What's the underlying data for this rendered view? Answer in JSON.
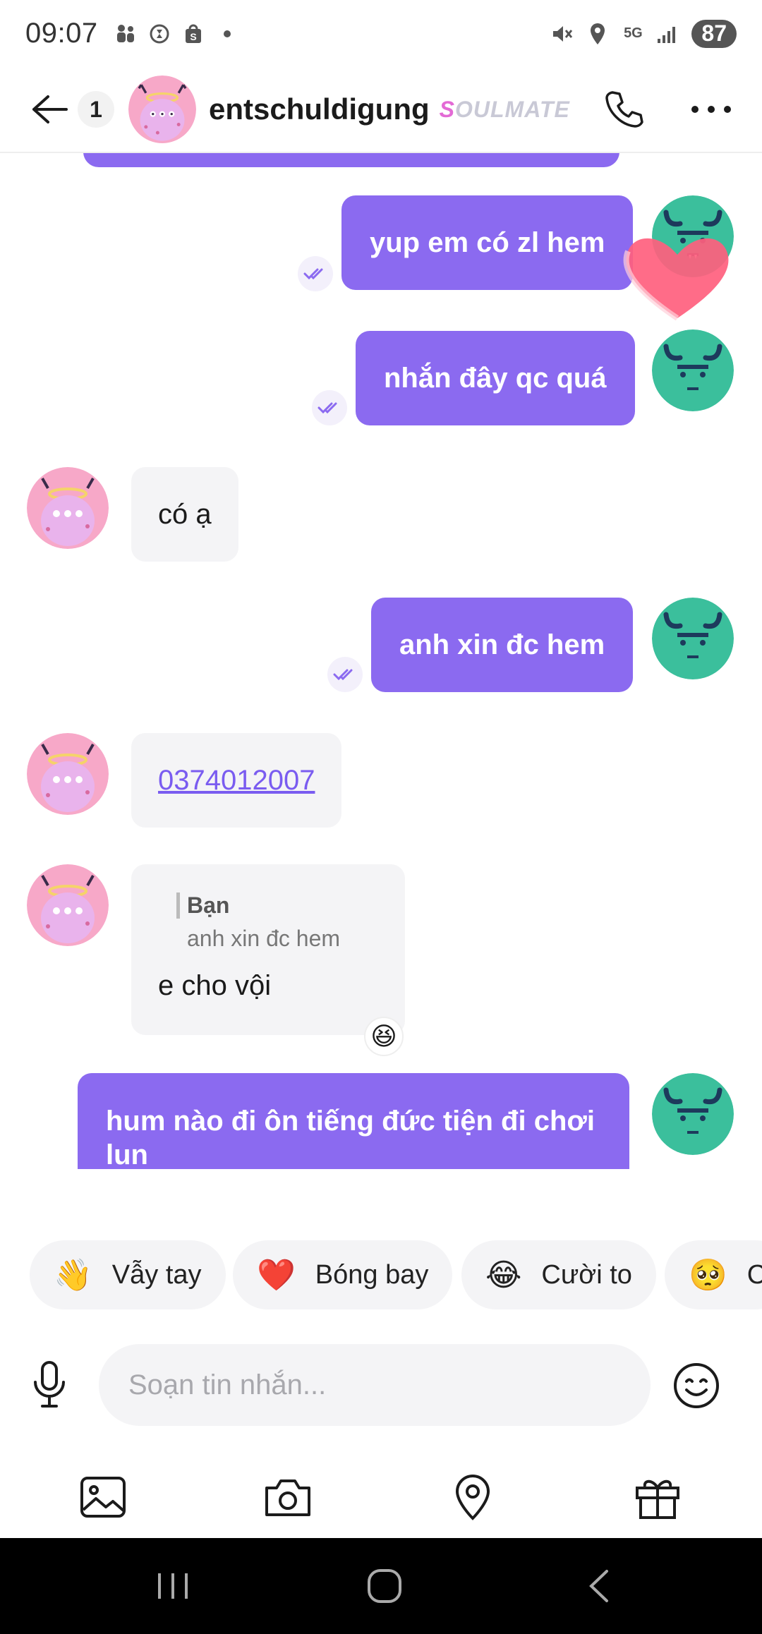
{
  "status_bar": {
    "time": "09:07",
    "battery": "87",
    "network": "5G"
  },
  "header": {
    "unread_count": "1",
    "contact_name": "entschuldigung",
    "badge_text": "OULMATE",
    "badge_initial": "S"
  },
  "messages": [
    {
      "direction": "out",
      "text": "yup em có zl hem"
    },
    {
      "direction": "out",
      "text": "nhắn đây qc quá"
    },
    {
      "direction": "in",
      "text": "có ạ"
    },
    {
      "direction": "out",
      "text": "anh xin đc hem"
    },
    {
      "direction": "in",
      "text": "0374012007",
      "is_link": true
    },
    {
      "direction": "in",
      "reply_to_name": "Bạn",
      "reply_to_text": "anh xin đc hem",
      "text": "e cho vội",
      "reaction": "😆"
    },
    {
      "direction": "out",
      "text": "hum nào đi ôn tiếng đức tiện đi chơi lun"
    }
  ],
  "quick_reactions": [
    {
      "emoji": "👋",
      "label": "Vẫy tay"
    },
    {
      "emoji": "❤️",
      "label": "Bóng bay"
    },
    {
      "emoji": "😂",
      "label": "Cười to"
    },
    {
      "emoji": "🥺",
      "label": "C"
    }
  ],
  "composer": {
    "placeholder": "Soạn tin nhắn..."
  },
  "colors": {
    "accent": "#8b6af0",
    "incoming_bubble": "#f4f4f6"
  },
  "icons": {
    "back": "arrow-left-icon",
    "call": "phone-icon",
    "more": "more-dots-icon",
    "mic": "microphone-icon",
    "emoji": "smiley-icon",
    "toolbar": [
      "image-icon",
      "camera-icon",
      "location-pin-icon",
      "gift-icon"
    ]
  }
}
